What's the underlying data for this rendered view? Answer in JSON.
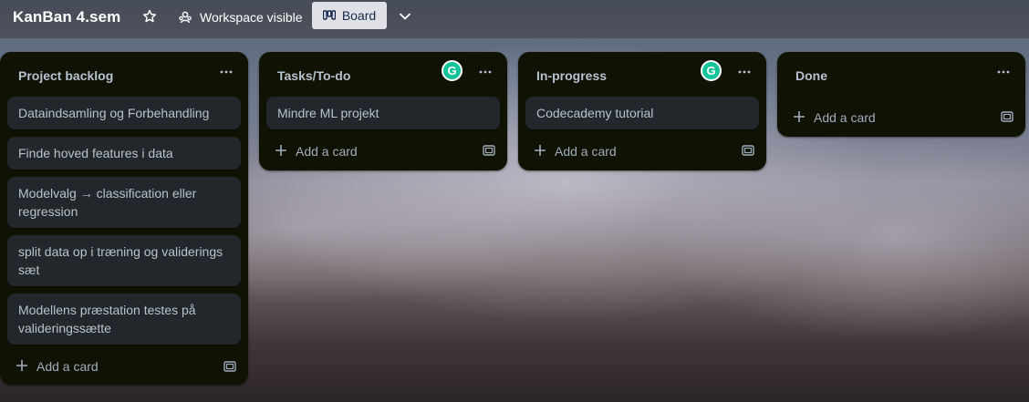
{
  "header": {
    "board_title": "KanBan 4.sem",
    "visibility_label": "Workspace visible",
    "view_label": "Board"
  },
  "lists": [
    {
      "title": "Project backlog",
      "cards": [
        "Dataindsamling og Forbehandling",
        "Finde hoved features i data",
        "Modelvalg → classification eller regression",
        "split data op i træning og validerings sæt",
        "Modellens præstation testes på valideringssætte"
      ],
      "add_label": "Add a card"
    },
    {
      "title": "Tasks/To-do",
      "cards": [
        "Mindre ML projekt"
      ],
      "add_label": "Add a card",
      "extension_icon": "grammarly-icon"
    },
    {
      "title": "In-progress",
      "cards": [
        "Codecademy tutorial"
      ],
      "add_label": "Add a card",
      "extension_icon": "grammarly-icon"
    },
    {
      "title": "Done",
      "cards": [],
      "add_label": "Add a card"
    }
  ],
  "icons": {
    "star": "star-icon",
    "visibility": "workspace-visibility-icon",
    "board": "board-view-icon",
    "chevron": "chevron-down-icon",
    "menu": "more-options-icon",
    "add": "plus-icon",
    "template": "create-from-template-icon"
  },
  "colors": {
    "list_bg": "#101204",
    "card_bg": "#22272b",
    "text": "#b6c2cf",
    "grammarly": "#15c39a"
  }
}
